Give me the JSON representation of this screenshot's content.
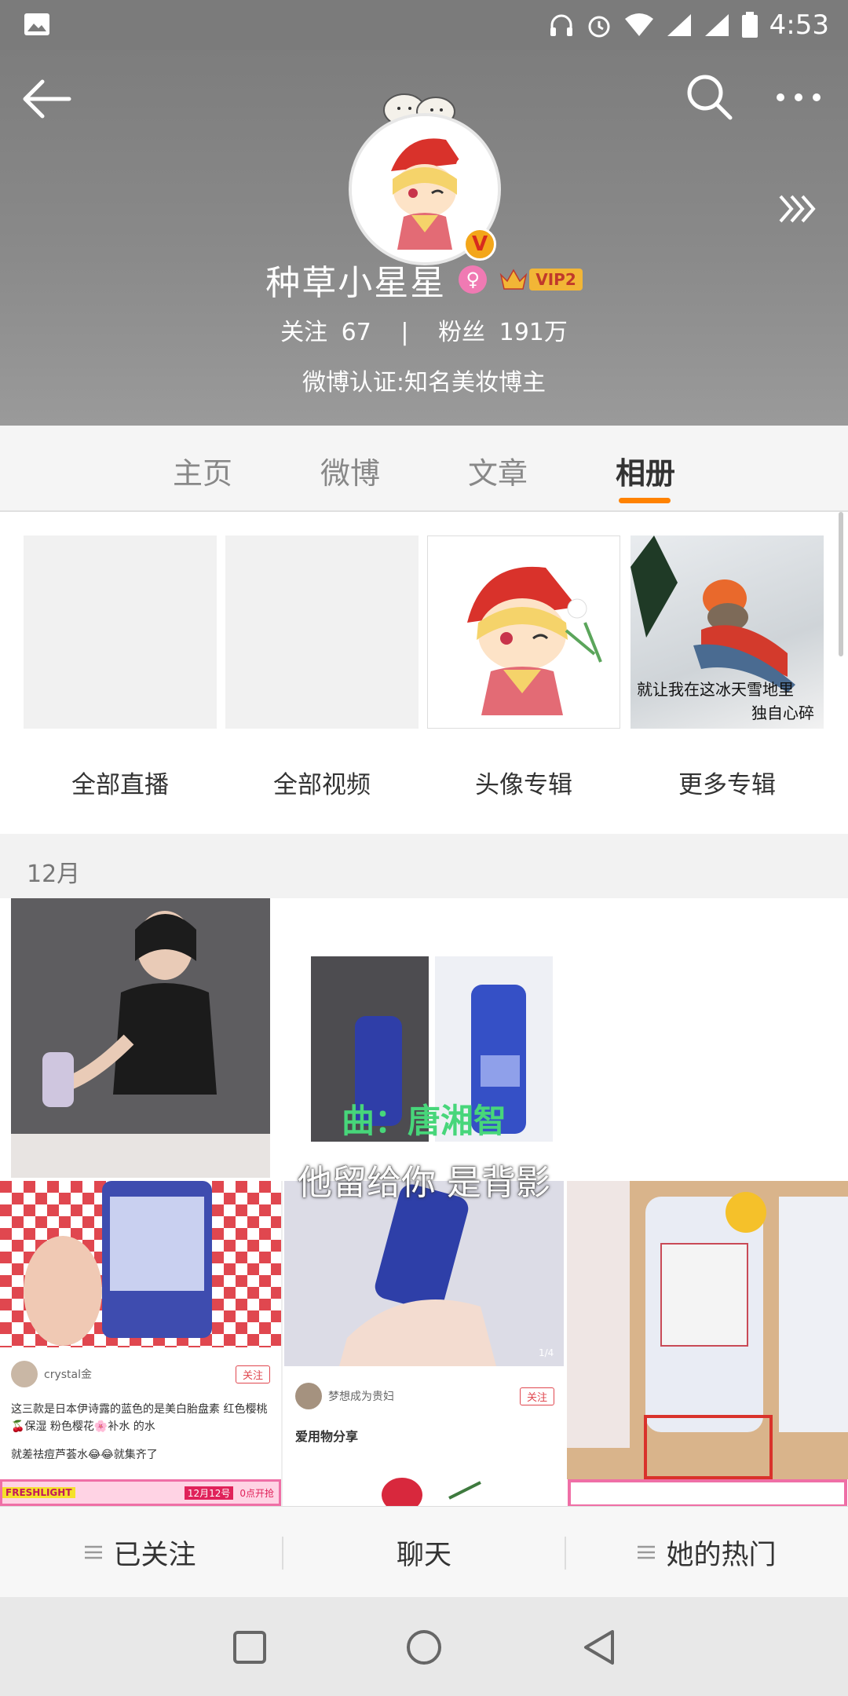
{
  "status_bar": {
    "time": "4:53"
  },
  "profile": {
    "name": "种草小星星",
    "vip_label": "VIP2",
    "follow_label": "关注",
    "follow_count": "67",
    "separator": "|",
    "fans_label": "粉丝",
    "fans_count": "191万",
    "verification": "微博认证:知名美妆博主"
  },
  "tabs": [
    {
      "label": "主页"
    },
    {
      "label": "微博"
    },
    {
      "label": "文章"
    },
    {
      "label": "相册"
    }
  ],
  "albums": [
    {
      "label": "全部直播"
    },
    {
      "label": "全部视频"
    },
    {
      "label": "头像专辑"
    },
    {
      "label": "更多专辑",
      "thumb_caption_line1": "就让我在这冰天雪地里",
      "thumb_caption_line2": "独自心碎"
    }
  ],
  "month": "12月",
  "photos": {
    "video_caption_1": "曲：唐湘智",
    "video_caption_2": "他留给你 是背影",
    "post1_user": "crystal金",
    "post1_follow": "关注",
    "post1_text": "这三款是日本伊诗露的蓝色的是美白胎盘素 红色樱桃🍒保湿 粉色樱花🌸补水 的水",
    "post1_text2": "就差祛痘芦荟水😂😂就集齐了",
    "post2_user": "梦想成为贵妇",
    "post2_follow": "关注",
    "post2_title": "爱用物分享",
    "post2_page": "1/4",
    "banner_brand": "FRESHLIGHT",
    "banner_date": "12月12号",
    "banner_time": "0点开抢"
  },
  "bottom_actions": {
    "followed": "已关注",
    "chat": "聊天",
    "hot": "她的热门"
  },
  "colors": {
    "accent": "#ff8200",
    "header_bg": "#828282"
  }
}
